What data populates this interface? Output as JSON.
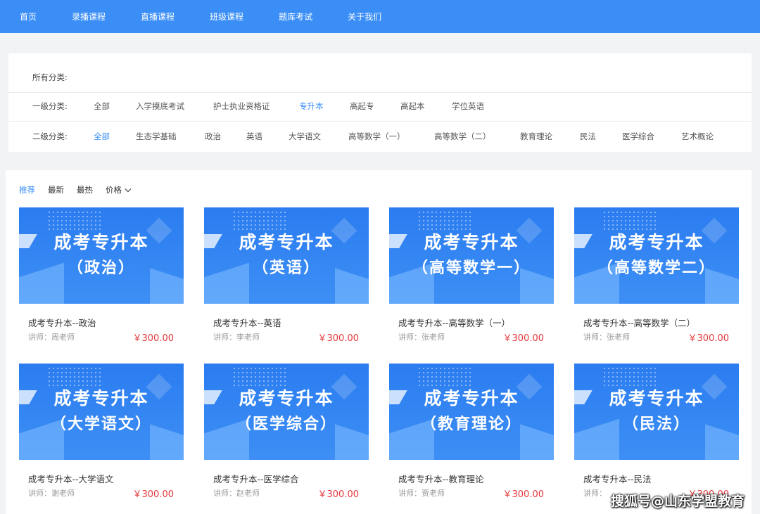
{
  "nav": [
    "首页",
    "录播课程",
    "直播课程",
    "班级课程",
    "题库考试",
    "关于我们"
  ],
  "filters": {
    "all_label": "所有分类:",
    "level1_label": "一级分类:",
    "level1": [
      "全部",
      "入学摸底考试",
      "护士执业资格证",
      "专升本",
      "高起专",
      "高起本",
      "学位英语"
    ],
    "level1_active": "专升本",
    "level2_label": "二级分类:",
    "level2": [
      "全部",
      "生态学基础",
      "政治",
      "英语",
      "大学语文",
      "高等数学（一）",
      "高等数学（二）",
      "教育理论",
      "民法",
      "医学综合",
      "艺术概论"
    ],
    "level2_active": "全部"
  },
  "sort": [
    "推荐",
    "最新",
    "最热",
    "价格"
  ],
  "sort_active": "推荐",
  "courses": [
    {
      "banner_main": "成考专升本",
      "banner_sub": "（政治）",
      "title": "成考专升本--政治",
      "teacher": "讲师：周老师",
      "price": "￥300.00"
    },
    {
      "banner_main": "成考专升本",
      "banner_sub": "（英语）",
      "title": "成考专升本--英语",
      "teacher": "讲师：李老师",
      "price": "￥300.00"
    },
    {
      "banner_main": "成考专升本",
      "banner_sub": "（高等数学一）",
      "title": "成考专升本--高等数学（一）",
      "teacher": "讲师：张老师",
      "price": "￥300.00"
    },
    {
      "banner_main": "成考专升本",
      "banner_sub": "（高等数学二）",
      "title": "成考专升本--高等数学（二）",
      "teacher": "讲师：张老师",
      "price": "￥300.00"
    },
    {
      "banner_main": "成考专升本",
      "banner_sub": "（大学语文）",
      "title": "成考专升本--大学语文",
      "teacher": "讲师：谢老师",
      "price": "￥300.00"
    },
    {
      "banner_main": "成考专升本",
      "banner_sub": "（医学综合）",
      "title": "成考专升本--医学综合",
      "teacher": "讲师：赵老师",
      "price": "￥300.00"
    },
    {
      "banner_main": "成考专升本",
      "banner_sub": "（教育理论）",
      "title": "成考专升本--教育理论",
      "teacher": "讲师：贾老师",
      "price": "￥300.00"
    },
    {
      "banner_main": "成考专升本",
      "banner_sub": "（民法）",
      "title": "成考专升本--民法",
      "teacher": "讲师：",
      "price": "￥300.00"
    }
  ],
  "watermark": "搜狐号@山东学盟教育",
  "colors": {
    "primary": "#3a8ef6",
    "price": "#e4393c"
  }
}
